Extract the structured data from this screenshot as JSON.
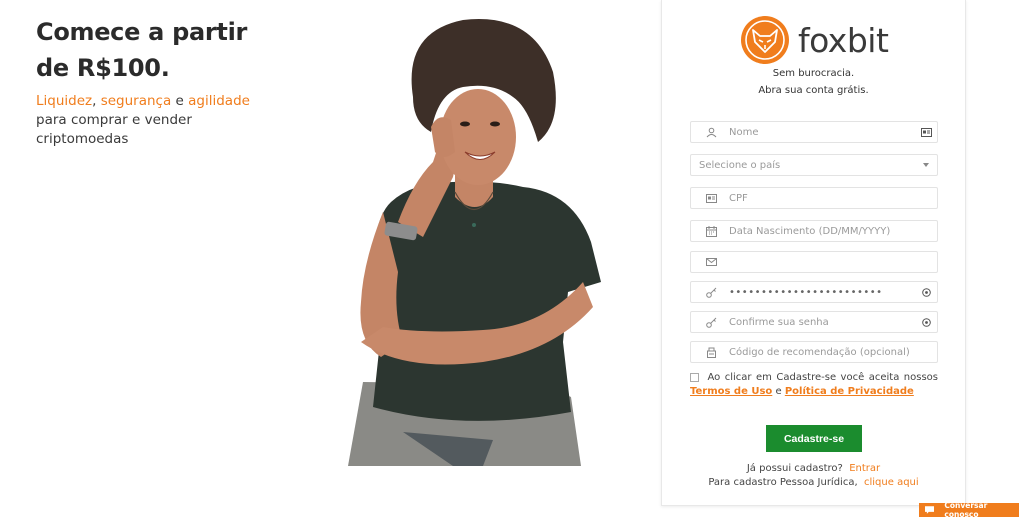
{
  "hero": {
    "title_line1": "Comece a partir",
    "title_line2": "de R$100.",
    "highlight1": "Liquidez",
    "sep1": ", ",
    "highlight2": "segurança",
    "sep2": " e ",
    "highlight3": "agilidade",
    "line2": "para comprar e vender",
    "line3": "criptomoedas"
  },
  "brand": {
    "name": "foxbit",
    "accent": "#f07d1d",
    "tagline1": "Sem burocracia.",
    "tagline2": "Abra sua conta grátis."
  },
  "form": {
    "name_placeholder": "Nome",
    "country_placeholder": "Selecione o país",
    "cpf_placeholder": "CPF",
    "birth_placeholder": "Data Nascimento (DD/MM/YYYY)",
    "email_value": "",
    "password_value": "••••••••••••••••••••••••",
    "confirm_placeholder": "Confirme sua senha",
    "referral_placeholder": "Código de recomendação (opcional)",
    "terms_text": "Ao clicar em Cadastre-se você aceita nossos",
    "terms_link": "Termos de Uso",
    "terms_and": "e",
    "privacy_link": "Política de Privacidade",
    "submit_label": "Cadastre-se",
    "submit_color": "#1b8c2e"
  },
  "footer": {
    "have_account": "Já possui cadastro?",
    "login_link": "Entrar",
    "company_text": "Para cadastro Pessoa Jurídica,",
    "company_link": "clique aqui"
  },
  "chat": {
    "label": "Conversar conosco"
  }
}
